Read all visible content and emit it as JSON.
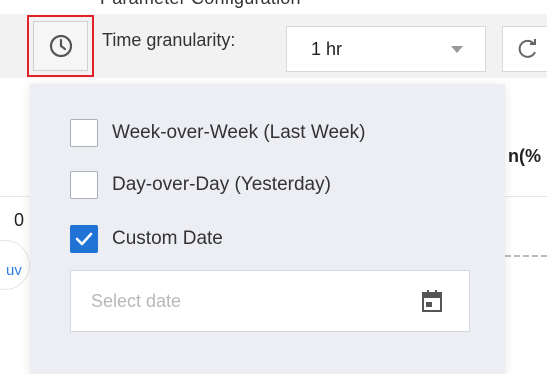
{
  "header": {
    "title": "Parameter Configuration"
  },
  "toolbar": {
    "granularity_label": "Time granularity:",
    "granularity_value": "1 hr"
  },
  "background": {
    "column_header_fragment": "n(%",
    "cell_value_fragment": "0",
    "link_fragment": "uv"
  },
  "comparison_panel": {
    "options": [
      {
        "label": "Week-over-Week (Last Week)",
        "checked": false
      },
      {
        "label": "Day-over-Day (Yesterday)",
        "checked": false
      },
      {
        "label": "Custom Date",
        "checked": true
      }
    ],
    "date_input": {
      "placeholder": "Select date",
      "value": ""
    }
  },
  "icons": {
    "time_compare": "clock-icon",
    "refresh": "refresh-icon",
    "dropdown": "chevron-down-icon",
    "date_picker": "calendar-icon",
    "check": "checkmark-icon"
  },
  "colors": {
    "highlight_border": "#e0202a",
    "checkbox_checked": "#2173d6",
    "panel_background": "#eceef3",
    "link": "#2f7de1"
  }
}
